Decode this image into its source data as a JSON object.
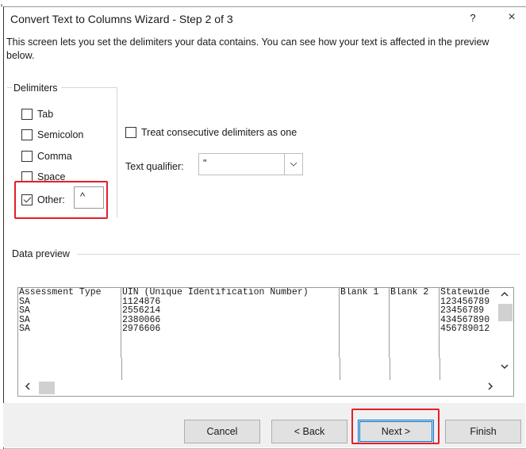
{
  "window": {
    "title": "Convert Text to Columns Wizard - Step 2 of 3",
    "help_label": "?",
    "close_label": "×"
  },
  "description": "This screen lets you set the delimiters your data contains.  You can see how your text is affected in the preview below.",
  "delimiters": {
    "group_label": "Delimiters",
    "tab": {
      "label": "Tab",
      "checked": false
    },
    "semicolon": {
      "label": "Semicolon",
      "checked": false
    },
    "comma": {
      "label": "Comma",
      "checked": false
    },
    "space": {
      "label": "Space",
      "checked": false
    },
    "other": {
      "label": "Other:",
      "checked": true,
      "value": "^"
    }
  },
  "consecutive": {
    "label": "Treat consecutive delimiters as one",
    "checked": false
  },
  "qualifier": {
    "label": "Text qualifier:",
    "value": "\""
  },
  "preview": {
    "label": "Data preview",
    "columns": [
      {
        "header": "Assessment Type",
        "cells": [
          "SA",
          "SA",
          "SA",
          "SA"
        ]
      },
      {
        "header": "UIN (Unique Identification Number)",
        "cells": [
          "1124876",
          "2556214",
          "2380066",
          "2976606"
        ]
      },
      {
        "header": "Blank 1",
        "cells": [
          "",
          "",
          "",
          ""
        ]
      },
      {
        "header": "Blank 2",
        "cells": [
          "",
          "",
          "",
          ""
        ]
      },
      {
        "header": "Statewide",
        "cells": [
          "123456789",
          "23456789",
          "434567890",
          "456789012"
        ]
      }
    ]
  },
  "buttons": {
    "cancel": "Cancel",
    "back": "< Back",
    "next": "Next >",
    "finish": "Finish"
  },
  "colors": {
    "highlight": "#e0202a",
    "focus_border": "#0078d7",
    "footer_bg": "#f0f0f0"
  }
}
